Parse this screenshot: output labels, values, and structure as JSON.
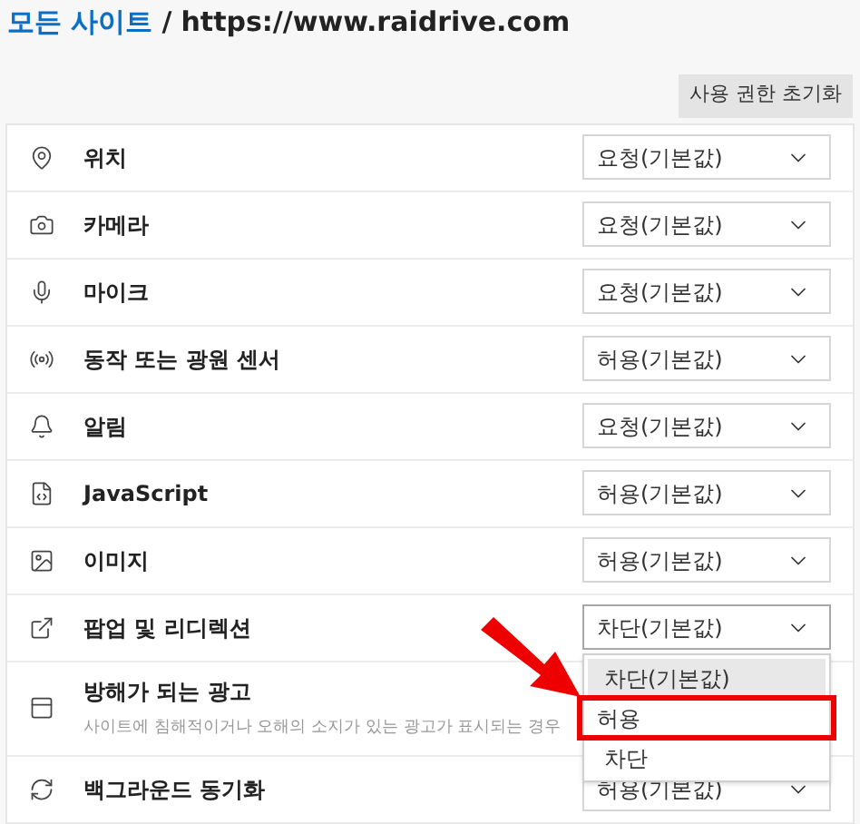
{
  "breadcrumb": {
    "link": "모든 사이트",
    "separator": "/",
    "site": "https://www.raidrive.com"
  },
  "reset_button": "사용 권한 초기화",
  "permissions": [
    {
      "label": "위치",
      "value": "요청(기본값)",
      "open": false
    },
    {
      "label": "카메라",
      "value": "요청(기본값)",
      "open": false
    },
    {
      "label": "마이크",
      "value": "요청(기본값)",
      "open": false
    },
    {
      "label": "동작 또는 광원 센서",
      "value": "허용(기본값)",
      "open": false
    },
    {
      "label": "알림",
      "value": "요청(기본값)",
      "open": false
    },
    {
      "label": "JavaScript",
      "value": "허용(기본값)",
      "open": false
    },
    {
      "label": "이미지",
      "value": "허용(기본값)",
      "open": false
    },
    {
      "label": "팝업 및 리디렉션",
      "value": "차단(기본값)",
      "open": true,
      "options": [
        {
          "label": "차단(기본값)",
          "selected": true,
          "marked": false
        },
        {
          "label": "허용",
          "selected": false,
          "marked": true
        },
        {
          "label": "차단",
          "selected": false,
          "marked": false
        }
      ]
    },
    {
      "label": "방해가 되는 광고",
      "description": "사이트에 침해적이거나 오해의 소지가 있는 광고가 표시되는 경우"
    },
    {
      "label": "백그라운드 동기화",
      "value": "허용(기본값)",
      "open": false
    }
  ]
}
